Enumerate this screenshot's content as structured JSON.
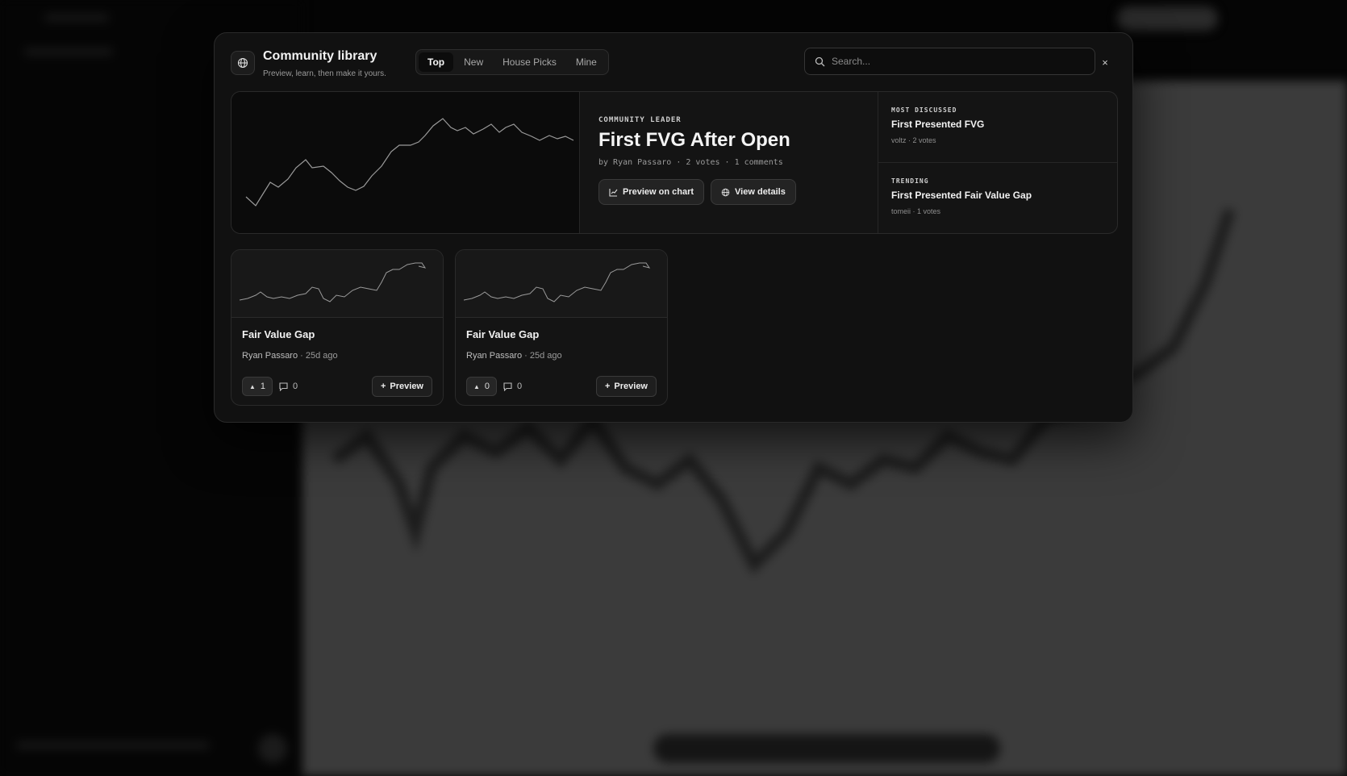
{
  "dialog": {
    "title": "Community library",
    "subtitle": "Preview, learn, then make it yours.",
    "globe_icon": "globe-icon",
    "close_label": "×"
  },
  "tabs": [
    {
      "label": "Top",
      "active": true
    },
    {
      "label": "New",
      "active": false
    },
    {
      "label": "House Picks",
      "active": false
    },
    {
      "label": "Mine",
      "active": false
    }
  ],
  "search": {
    "placeholder": "Search...",
    "value": ""
  },
  "featured": {
    "eyebrow": "COMMUNITY LEADER",
    "title": "First FVG After Open",
    "meta": "by Ryan Passaro · 2 votes · 1 comments",
    "preview_label": "Preview on chart",
    "details_label": "View details"
  },
  "side": [
    {
      "eyebrow": "MOST DISCUSSED",
      "title": "First Presented FVG",
      "meta": "voltz · 2 votes"
    },
    {
      "eyebrow": "TRENDING",
      "title": "First Presented Fair Value Gap",
      "meta": "tomeii · 1 votes"
    }
  ],
  "cards": [
    {
      "title": "Fair Value Gap",
      "author": "Ryan Passaro",
      "age": "· 25d ago",
      "votes": "1",
      "comments": "0",
      "preview_label": "Preview"
    },
    {
      "title": "Fair Value Gap",
      "author": "Ryan Passaro",
      "age": "· 25d ago",
      "votes": "0",
      "comments": "0",
      "preview_label": "Preview"
    }
  ],
  "colors": {
    "accent_line": "#9a9a9a",
    "bg": "#111111"
  }
}
